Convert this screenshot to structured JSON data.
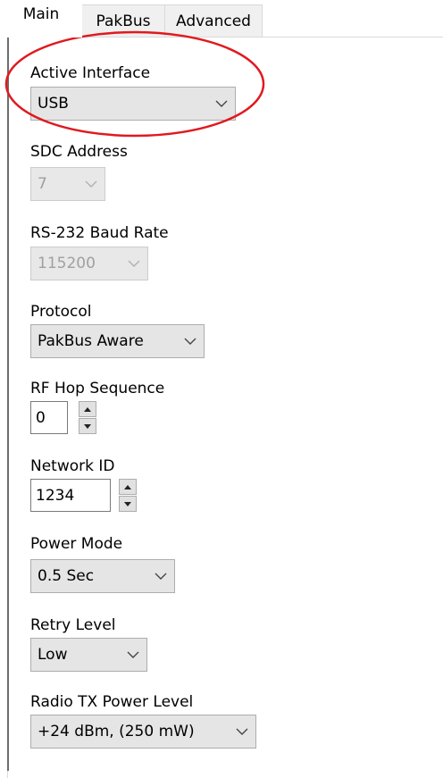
{
  "tabs": [
    {
      "label": "Main",
      "active": true
    },
    {
      "label": "PakBus",
      "active": false
    },
    {
      "label": "Advanced",
      "active": false
    }
  ],
  "fields": {
    "active_interface": {
      "label": "Active Interface",
      "value": "USB"
    },
    "sdc_address": {
      "label": "SDC Address",
      "value": "7",
      "disabled": true
    },
    "rs232_baud": {
      "label": "RS-232 Baud Rate",
      "value": "115200",
      "disabled": true
    },
    "protocol": {
      "label": "Protocol",
      "value": "PakBus Aware"
    },
    "rf_hop": {
      "label": "RF Hop Sequence",
      "value": "0"
    },
    "network_id": {
      "label": "Network ID",
      "value": "1234"
    },
    "power_mode": {
      "label": "Power Mode",
      "value": "0.5 Sec"
    },
    "retry_level": {
      "label": "Retry Level",
      "value": "Low"
    },
    "tx_power": {
      "label": "Radio TX Power Level",
      "value": "+24 dBm, (250 mW)"
    }
  },
  "annotation": {
    "color": "#e0191f"
  },
  "icons": {
    "dropdown": "chevron-down-icon",
    "spin_up": "arrow-up-icon",
    "spin_down": "arrow-down-icon"
  }
}
